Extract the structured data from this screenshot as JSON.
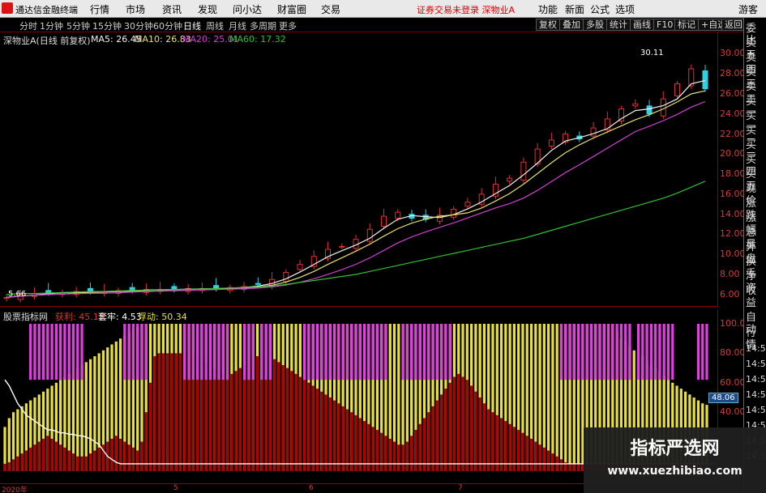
{
  "app": {
    "title": "通达信金融终端"
  },
  "menu": [
    "行情",
    "市场",
    "资讯",
    "发现",
    "问小达",
    "财富圈",
    "交易"
  ],
  "warning": "证券交易未登录  深物业A",
  "menu_right": [
    "功能",
    "新面",
    "公式",
    "选项"
  ],
  "guest": "游客",
  "periods": [
    "分时",
    "1分钟",
    "5分钟",
    "15分钟",
    "30分钟",
    "60分钟",
    "日线",
    "周线",
    "月线",
    "多周期",
    "更多"
  ],
  "active_period": "日线",
  "tools": [
    "复权",
    "叠加",
    "多股",
    "统计",
    "画线",
    "F10",
    "标记",
    "+自选",
    "返回"
  ],
  "main_legend": {
    "stock": "深物业A(日线 前复权)",
    "ma5": "MA5: 26.45",
    "ma10": "MA10: 26.83",
    "ma20": "MA20: 25.01",
    "ma60": "MA60: 17.32"
  },
  "price_labels": [
    "30.00",
    "28.00",
    "26.00",
    "24.00",
    "22.00",
    "20.00",
    "18.00",
    "16.00",
    "14.00",
    "12.00",
    "10.00",
    "8.00",
    "6.00"
  ],
  "high_mark": "30.11",
  "low_mark": "5.66",
  "ind_legend": {
    "name": "股票指标网",
    "a": "获利: 45.13",
    "b": "套牢: 4.53",
    "c": "浮动: 50.34"
  },
  "ind_labels": [
    "100.00",
    "80.00",
    "60.00",
    "40.00"
  ],
  "current_value": "48.06",
  "dates": [
    "2020年",
    "5",
    "6",
    "7"
  ],
  "right_panel_top": [
    "委比",
    "卖五",
    "卖四",
    "卖三",
    "卖二",
    "卖一",
    "买一",
    "买二",
    "买三",
    "买四",
    "买五",
    "现价",
    "涨跌",
    "涨幅",
    "总量",
    "外盘",
    "换手",
    "净资",
    "收益"
  ],
  "right_panel_bottom": [
    "自动",
    "行情",
    "14:50",
    "14:50",
    "14:50",
    "14:50",
    "14:50",
    "14:50",
    "14:50",
    "14:50"
  ],
  "watermark": {
    "line1": "指标严选网",
    "line2": "www.xuezhibiao.com"
  },
  "colors": {
    "up": "#e03030",
    "down": "#30d0e0",
    "ma5": "#f0f0f0",
    "ma10": "#e8e070",
    "ma20": "#d040d0",
    "ma60": "#30c030",
    "profit": "#e8e040",
    "trapped": "#b00000",
    "float": "#ffffff",
    "signal": "#e040e0"
  },
  "chart_data": [
    {
      "type": "line",
      "title": "深物业A(日线 前复权)",
      "series_names": [
        "MA5",
        "MA10",
        "MA20",
        "MA60"
      ],
      "price_range": [
        5.5,
        31
      ],
      "close": [
        5.7,
        6.0,
        6.1,
        6.2,
        6.2,
        6.3,
        6.3,
        6.3,
        6.4,
        6.4,
        6.5,
        6.5,
        6.5,
        6.6,
        6.6,
        6.6,
        6.7,
        6.8,
        7.0,
        7.5,
        8.2,
        9.0,
        9.8,
        10.5,
        10.8,
        11.5,
        12.5,
        13.8,
        14.2,
        13.6,
        13.5,
        13.9,
        14.5,
        15.2,
        16.0,
        17.0,
        17.6,
        19.2,
        20.5,
        21.4,
        22.0,
        21.5,
        22.6,
        23.5,
        24.5,
        25.0,
        24.0,
        25.5,
        27.0,
        28.5,
        26.5
      ],
      "ma60": [
        6.0,
        6.1,
        6.1,
        6.15,
        6.2,
        6.25,
        6.3,
        6.3,
        6.35,
        6.4,
        6.4,
        6.45,
        6.5,
        6.5,
        6.55,
        6.6,
        6.65,
        6.7,
        6.75,
        6.85,
        7.0,
        7.2,
        7.4,
        7.6,
        7.8,
        8.0,
        8.3,
        8.6,
        8.9,
        9.2,
        9.5,
        9.8,
        10.1,
        10.4,
        10.7,
        11.0,
        11.3,
        11.6,
        12.0,
        12.4,
        12.8,
        13.2,
        13.6,
        14.0,
        14.4,
        14.8,
        15.2,
        15.6,
        16.1,
        16.7,
        17.3
      ]
    },
    {
      "type": "bar",
      "title": "股票指标网",
      "series_names": [
        "获利",
        "套牢",
        "浮动"
      ],
      "y_range": [
        0,
        100
      ],
      "profit": [
        30,
        36,
        40,
        42,
        44,
        46,
        48,
        50,
        52,
        54,
        56,
        58,
        60,
        62,
        64,
        66,
        68,
        70,
        72,
        74,
        76,
        78,
        80,
        82,
        84,
        86,
        88,
        90,
        92,
        94,
        96,
        98,
        100,
        100,
        100,
        100,
        100,
        100,
        100,
        100,
        100,
        100,
        100,
        100,
        100,
        100,
        100,
        100,
        100,
        100,
        100,
        100,
        100,
        100,
        100,
        100,
        100,
        100,
        100,
        100,
        100,
        100,
        100,
        100,
        100,
        100,
        100,
        100,
        100,
        100,
        100,
        100,
        100,
        100,
        100,
        100,
        100,
        100,
        100,
        100,
        100,
        100,
        100,
        100,
        100,
        100,
        100,
        100,
        100,
        100,
        100,
        100,
        100,
        100,
        100,
        100,
        100,
        100,
        100,
        100,
        100,
        100,
        100,
        100,
        100,
        100,
        100,
        100,
        100,
        100,
        100,
        100,
        100,
        100,
        100,
        100,
        100,
        100,
        100,
        100,
        100,
        100,
        100,
        100,
        100,
        100,
        100,
        100,
        100,
        100,
        100,
        100,
        100,
        100,
        100,
        100,
        100,
        100,
        100,
        100,
        100,
        100,
        100,
        95,
        90,
        88,
        85,
        82,
        80,
        78,
        75,
        72,
        70,
        68,
        65,
        62,
        60,
        58,
        56,
        54,
        52,
        50,
        48,
        46,
        45
      ],
      "trapped": [
        5,
        6,
        8,
        10,
        12,
        14,
        16,
        18,
        20,
        22,
        24,
        22,
        20,
        18,
        16,
        14,
        12,
        10,
        10,
        10,
        12,
        14,
        16,
        18,
        20,
        22,
        24,
        22,
        20,
        18,
        16,
        14,
        20,
        40,
        60,
        78,
        80,
        80,
        80,
        80,
        80,
        80,
        80,
        80,
        80,
        78,
        76,
        74,
        72,
        70,
        68,
        66,
        64,
        66,
        68,
        70,
        72,
        74,
        76,
        78,
        80,
        80,
        78,
        76,
        74,
        72,
        70,
        68,
        66,
        64,
        62,
        60,
        58,
        56,
        54,
        52,
        50,
        48,
        46,
        44,
        42,
        40,
        38,
        36,
        34,
        32,
        30,
        28,
        26,
        24,
        22,
        20,
        18,
        18,
        20,
        24,
        28,
        32,
        36,
        40,
        44,
        48,
        52,
        56,
        60,
        64,
        66,
        64,
        62,
        58,
        54,
        50,
        46,
        42,
        40,
        38,
        36,
        34,
        32,
        30,
        28,
        26,
        24,
        22,
        20,
        18,
        16,
        14,
        12,
        10,
        8,
        6,
        5,
        5,
        5,
        5,
        5,
        5,
        5,
        5,
        5,
        5,
        5,
        5,
        5,
        5,
        5,
        5,
        5,
        5,
        5,
        5,
        5,
        5,
        5,
        5,
        5,
        5,
        5,
        5,
        5,
        5,
        5,
        5,
        5,
        5,
        5
      ],
      "float_line": [
        62,
        58,
        52,
        46,
        42,
        38,
        36,
        34,
        32,
        30,
        28,
        28,
        27,
        26,
        26,
        25,
        25,
        24,
        24,
        23,
        22,
        20,
        18,
        14,
        10,
        8,
        6,
        5,
        5,
        5,
        5,
        5,
        5,
        5,
        5,
        5,
        5,
        5,
        5,
        5,
        5,
        5,
        5,
        5,
        5,
        5,
        5,
        5,
        5,
        5,
        5,
        5,
        5,
        5,
        5,
        5,
        5,
        5,
        5,
        5,
        5,
        5,
        5,
        5,
        5,
        5,
        5,
        5,
        5,
        5,
        5,
        5,
        5,
        5,
        5,
        5,
        5,
        5,
        5,
        5,
        5,
        5,
        5,
        5,
        5,
        5,
        5,
        5,
        5,
        5,
        5,
        5,
        5,
        5,
        5,
        5,
        5,
        5,
        5,
        5,
        5,
        5,
        5,
        5,
        5,
        5,
        5,
        5,
        5,
        5,
        5,
        5,
        5,
        5,
        5,
        5,
        5,
        5,
        5,
        5,
        5,
        5,
        5,
        5,
        5,
        5,
        5,
        5,
        5,
        5,
        5,
        5,
        5,
        5,
        5,
        5,
        5,
        5,
        5,
        5,
        5,
        5,
        5,
        5,
        5,
        5,
        5,
        5,
        5,
        5,
        5,
        5,
        5,
        5,
        5,
        5,
        5,
        5,
        5,
        5,
        5,
        5,
        5,
        5,
        5,
        5,
        5
      ]
    }
  ]
}
